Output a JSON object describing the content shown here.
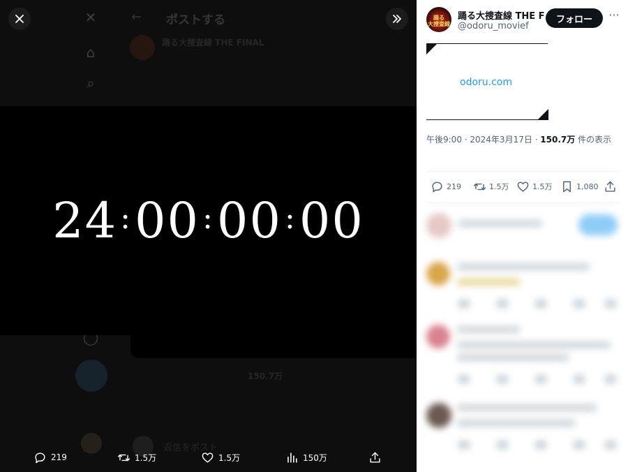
{
  "modal": {
    "close_icon": "close-icon",
    "expand_icon": "double-chevron-right-icon",
    "timer": {
      "hh": "24",
      "mm": "00",
      "ss": "00",
      "ff": "00"
    },
    "background": {
      "header_title": "ポストする",
      "author": "踊る大捜査線 THE FINAL",
      "views_text": "150.7万",
      "reply_label": "返信をポスト"
    },
    "actions": [
      {
        "icon": "reply-icon",
        "count": "219"
      },
      {
        "icon": "retweet-icon",
        "count": "1.5万"
      },
      {
        "icon": "like-icon",
        "count": "1.5万"
      },
      {
        "icon": "views-icon",
        "count": "150万"
      },
      {
        "icon": "share-icon",
        "count": ""
      }
    ]
  },
  "panel": {
    "account": {
      "name": "踊る大捜査線 THE F",
      "handle": "@odoru_movief",
      "follow_label": "フォロー"
    },
    "link_text": "odoru.com",
    "meta": {
      "time": "午後9:00 · 2024年3月17日 · ",
      "views": "150.7万",
      "views_suffix": " 件の表示"
    },
    "stats": [
      {
        "icon": "reply-icon",
        "count": "219"
      },
      {
        "icon": "retweet-icon",
        "count": "1.5万"
      },
      {
        "icon": "like-icon",
        "count": "1.5万"
      },
      {
        "icon": "bookmark-icon",
        "count": "1,080"
      },
      {
        "icon": "share-icon",
        "count": ""
      }
    ]
  },
  "colors": {
    "accent": "#1d9bf0",
    "text_primary": "#0f1419",
    "text_secondary": "#536471",
    "dark_bg": "#000000"
  }
}
